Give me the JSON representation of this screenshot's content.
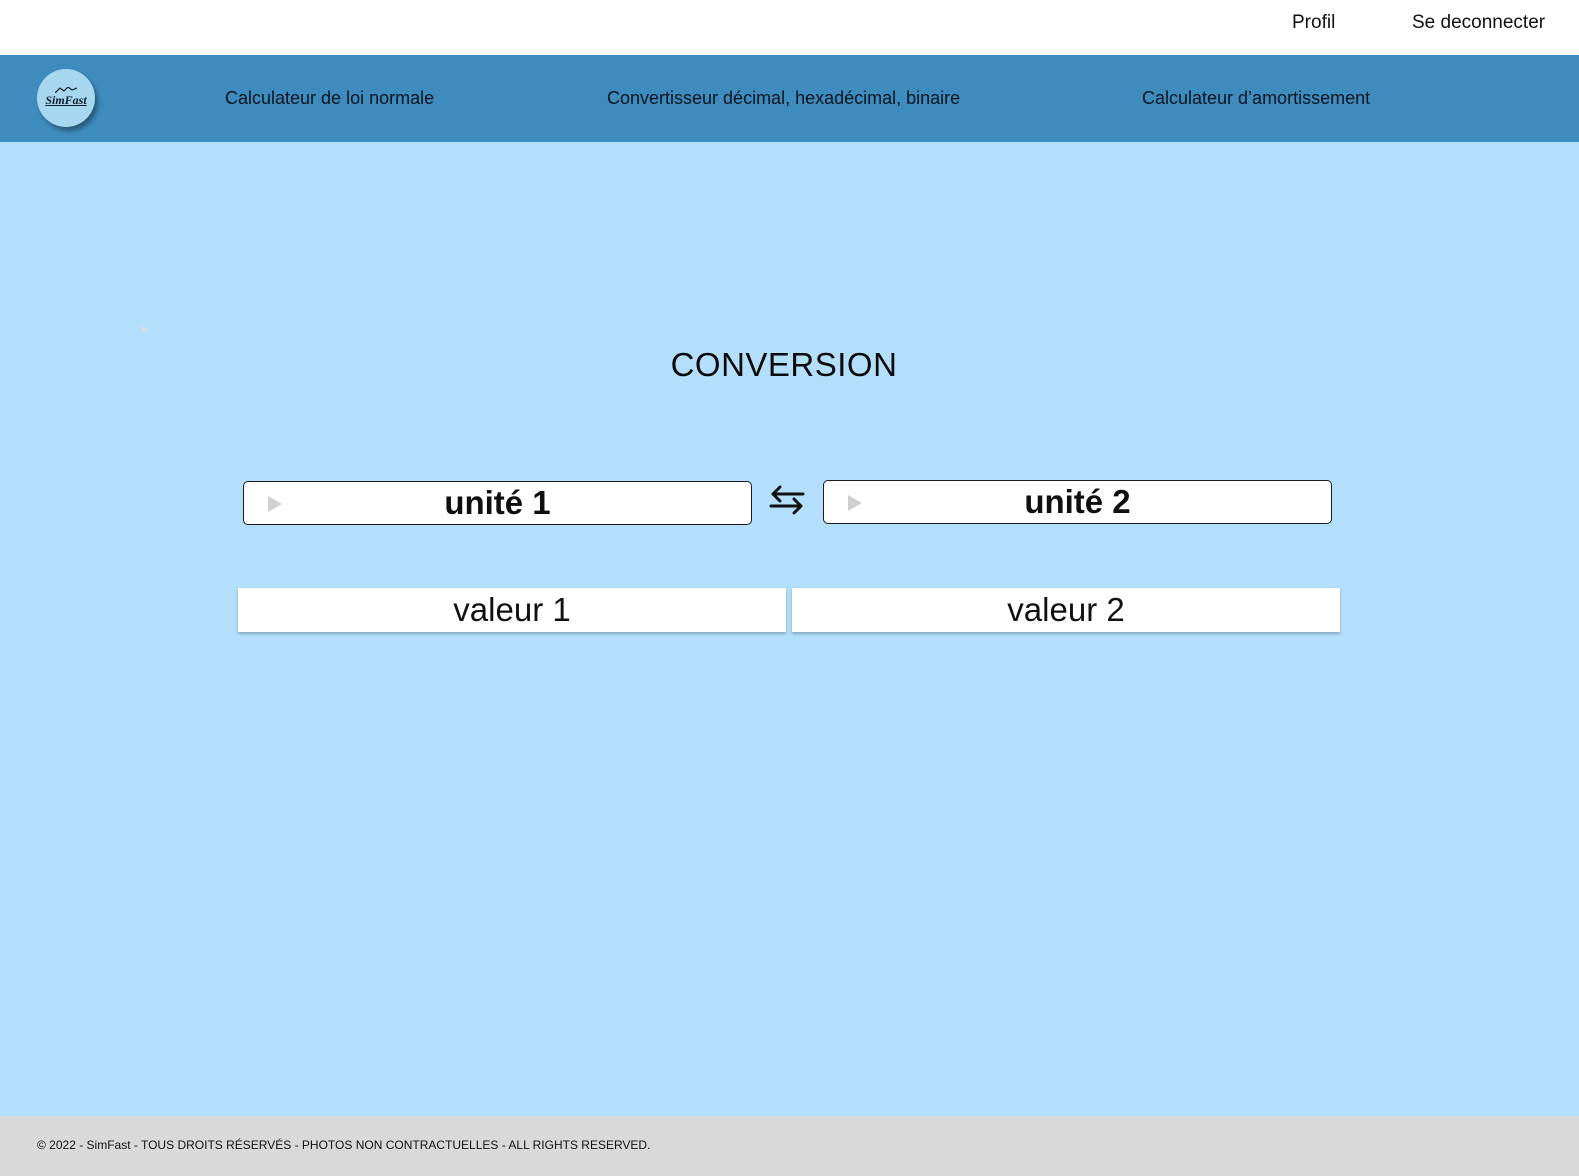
{
  "topbar": {
    "profile_label": "Profil",
    "logout_label": "Se deconnecter"
  },
  "logo": {
    "text": "SimFast"
  },
  "navbar": {
    "links": [
      {
        "label": "Calculateur de loi normale"
      },
      {
        "label": "Convertisseur décimal, hexadécimal, binaire"
      },
      {
        "label": "Calculateur d’amortissement"
      }
    ]
  },
  "main": {
    "title": "CONVERSION",
    "unit_1_label": "unité 1",
    "unit_2_label": "unité 2",
    "swap_symbol": "⇆",
    "value_1_placeholder": "valeur 1",
    "value_2_placeholder": "valeur 2"
  },
  "footer": {
    "text": "© 2022 - SimFast - TOUS DROITS RÉSERVÉS - PHOTOS NON CONTRACTUELLES - ALL RIGHTS RESERVED."
  },
  "colors": {
    "page_background": "#b3dffc",
    "navbar_background": "#3e8bbd",
    "footer_background": "#d9d9d9",
    "logo_background": "#a6d7ee"
  }
}
